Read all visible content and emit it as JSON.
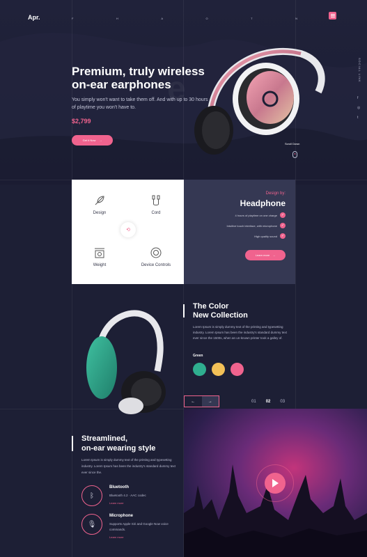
{
  "header": {
    "logo": "Apr.",
    "nav": [
      "F",
      "H",
      "A",
      "O",
      "T",
      "N"
    ],
    "menu_icon": "menu-icon"
  },
  "hero": {
    "bg_word": "e",
    "title_line1": "Premium, truly wireless",
    "title_line2": "on-ear earphones",
    "subtitle": "You simply won't want to take them off. And with up to 30 hours of playtime you won't have to.",
    "price": "$2,799",
    "cta_label": "Get it Now",
    "cta_arrow": "→",
    "social_label": "SOCIAL LINK",
    "social_icons": [
      "f",
      "◎",
      "t"
    ],
    "scroll_down": "Scroll Down"
  },
  "features": {
    "items": [
      {
        "label": "Design",
        "icon": "feather-icon"
      },
      {
        "label": "Cord",
        "icon": "cable-icon"
      },
      {
        "label": "Weight",
        "icon": "scale-icon"
      },
      {
        "label": "Device Controls",
        "icon": "controls-icon"
      }
    ],
    "center_icon": "⟲",
    "design_by": "Design by:",
    "title": "Headphone",
    "list": [
      "4 hours of playtime on one charge",
      "Intuitive touch interface, with microphone",
      "High quality sound"
    ],
    "check": "✓",
    "learn_more": "Learn more",
    "learn_arrow": "→"
  },
  "collection": {
    "title_line1": "The Color",
    "title_line2": "New Collection",
    "description": "Lorem Ipsum is simply dummy text of the printing and typesetting industry. Lorem Ipsum has been the industry's standard dummy text ever since the 1500s, when an un-known printer took a galley of.",
    "color_label": "Green",
    "swatches": [
      "#2fae8f",
      "#f2c057",
      "#f0638e"
    ],
    "prev": "←",
    "next": "→",
    "pages": [
      "01",
      "02",
      "03"
    ],
    "active_page": "02"
  },
  "streamlined": {
    "title_line1": "Streamlined,",
    "title_line2": "on-ear wearing style",
    "description": "Lorem Ipsum is simply dummy text of the printing and typesetting industry. Lorem Ipsum has been the industry's standard dummy text ever since the.",
    "specs": [
      {
        "title": "Bluetooth",
        "desc": "Bluetooth 4.2 · AAC codec",
        "link": "Learn more",
        "icon": "bluetooth-icon",
        "glyph": "ᛒ"
      },
      {
        "title": "Microphone",
        "desc": "Supports Apple Siri and Google Now voice commands.",
        "link": "Learn more",
        "icon": "microphone-icon",
        "glyph": "🎙"
      }
    ]
  },
  "colors": {
    "accent": "#f0638e",
    "background": "#1d1f35",
    "panel": "#353853"
  }
}
